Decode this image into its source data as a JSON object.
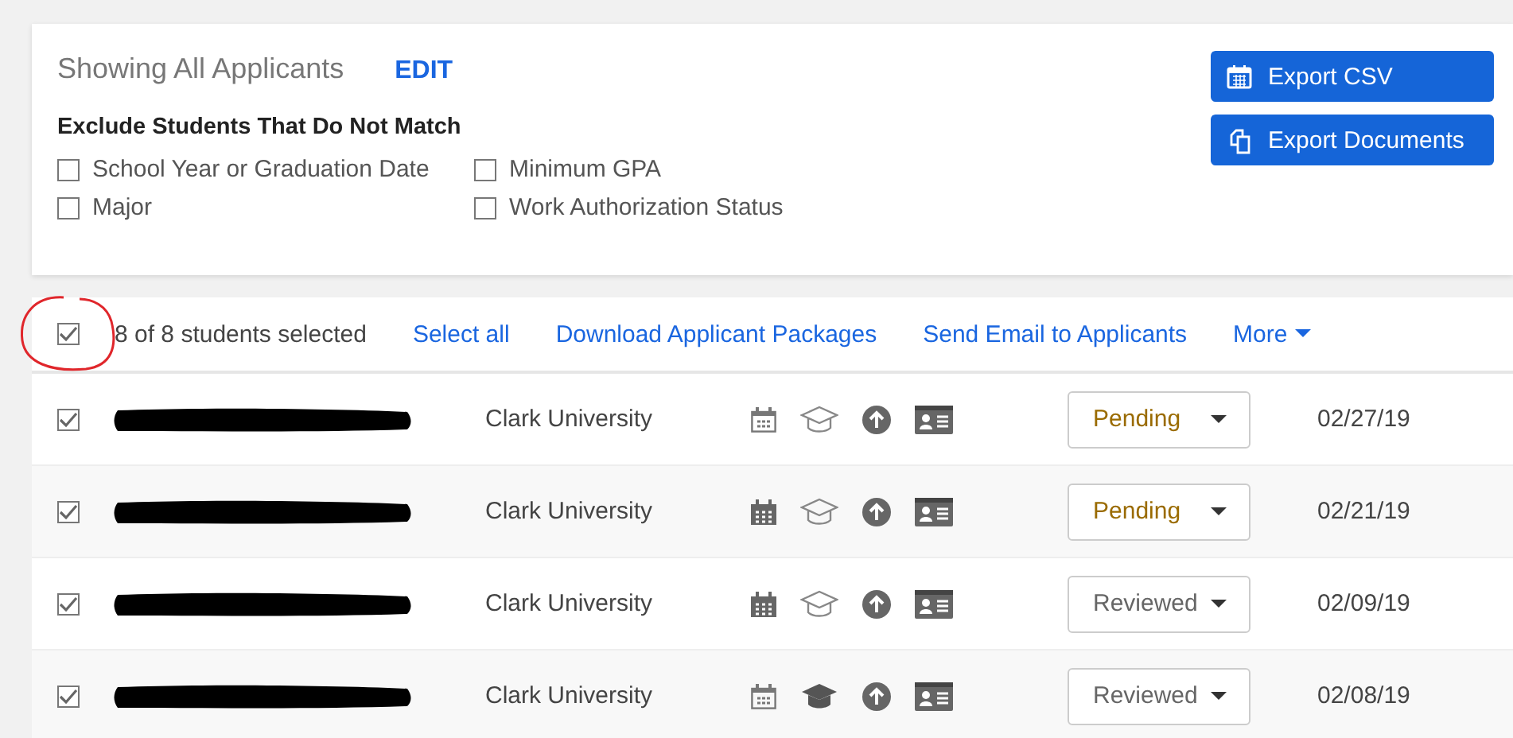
{
  "filter_panel": {
    "title": "Showing All Applicants",
    "edit_link": "EDIT",
    "subtitle": "Exclude Students That Do Not Match",
    "options": [
      {
        "label": "School Year or Graduation Date",
        "checked": false
      },
      {
        "label": "Minimum GPA",
        "checked": false
      },
      {
        "label": "Major",
        "checked": false
      },
      {
        "label": "Work Authorization Status",
        "checked": false
      }
    ],
    "buttons": [
      {
        "kind": "calendar",
        "label": "Export CSV"
      },
      {
        "kind": "documents",
        "label": "Export Documents"
      }
    ]
  },
  "toolbar": {
    "select_all_checked": true,
    "count": "8 of 8 students selected",
    "actions": [
      "Select all",
      "Download Applicant Packages",
      "Send Email to Applicants"
    ],
    "more": "More"
  },
  "rows": [
    {
      "checked": true,
      "school": "Clark University",
      "calendar_filled": false,
      "cap_filled": false,
      "status": {
        "kind": "pending",
        "label": "Pending"
      },
      "date": "02/27/19"
    },
    {
      "checked": true,
      "school": "Clark University",
      "calendar_filled": true,
      "cap_filled": false,
      "status": {
        "kind": "pending",
        "label": "Pending"
      },
      "date": "02/21/19"
    },
    {
      "checked": true,
      "school": "Clark University",
      "calendar_filled": true,
      "cap_filled": false,
      "status": {
        "kind": "reviewed",
        "label": "Reviewed"
      },
      "date": "02/09/19"
    },
    {
      "checked": true,
      "school": "Clark University",
      "calendar_filled": false,
      "cap_filled": true,
      "status": {
        "kind": "reviewed",
        "label": "Reviewed"
      },
      "date": "02/08/19"
    }
  ]
}
